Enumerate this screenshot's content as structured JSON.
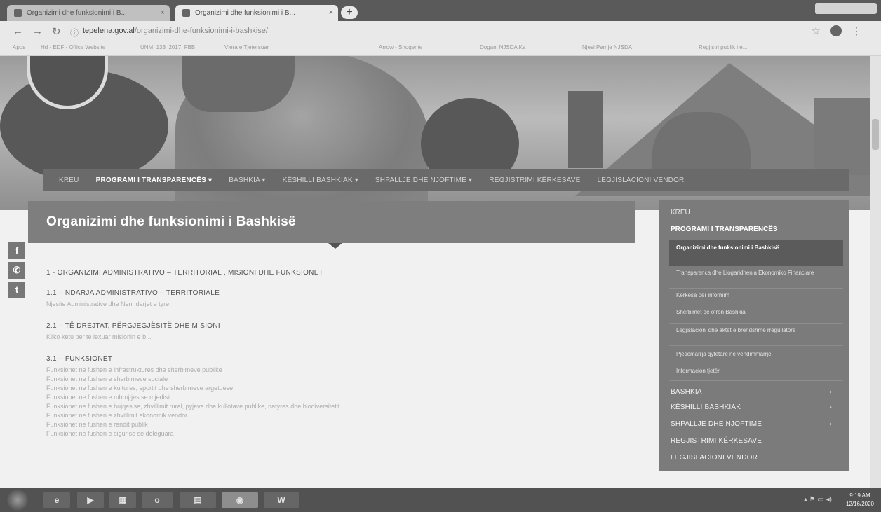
{
  "browser": {
    "tabs": [
      {
        "label": "Organizimi dhe funksionimi i B...",
        "active": false
      },
      {
        "label": "Organizimi dhe funksionimi i B...",
        "active": true
      }
    ],
    "url_domain": "tepelena.gov.al",
    "url_path": "/organizimi-dhe-funksionimi-i-bashkise/",
    "bookmarks": [
      "Apps",
      "Hd - EDF - Office Website",
      "UNM_133_2017_FBB",
      "Vlera e Tjetersuar",
      "Arrow - Shoqerite",
      "Doganj NJSDA Ka",
      "Njesi Pamje NJSDA",
      "Regjistri publik i e..."
    ]
  },
  "site": {
    "nav": [
      {
        "label": "KREU",
        "active": false
      },
      {
        "label": "PROGRAMI I TRANSPARENCËS",
        "dropdown": true,
        "active": true
      },
      {
        "label": "BASHKIA",
        "dropdown": true,
        "active": false
      },
      {
        "label": "KËSHILLI BASHKIAK",
        "dropdown": true,
        "active": false
      },
      {
        "label": "SHPALLJE DHE NJOFTIME",
        "dropdown": true,
        "active": false
      },
      {
        "label": "REGJISTRIMI KËRKESAVE",
        "active": false
      },
      {
        "label": "LEGJISLACIONI VENDOR",
        "active": false
      }
    ],
    "social": [
      "facebook-icon",
      "whatsapp-icon",
      "twitter-icon"
    ],
    "page_title": "Organizimi dhe funksionimi i Bashkisë",
    "content": {
      "main_heading": "1 - ORGANIZIMI ADMINISTRATIVO – TERRITORIAL , MISIONI DHE FUNKSIONET",
      "sections": [
        {
          "heading": "1.1 – NDARJA ADMINISTRATIVO – TERRITORIALE",
          "lines": [
            "Njesite Administrative dhe Nenndarjet e tyre"
          ]
        },
        {
          "heading": "2.1 – TË DREJTAT, PËRGJEGJËSITË DHE MISIONI",
          "lines": [
            "Kliko ketu per te lexuar misionin e b..."
          ]
        },
        {
          "heading": "3.1 – FUNKSIONET",
          "lines": [
            "Funksionet ne fushen e infrastruktures dhe sherbimeve publike",
            "Funksionet ne fushen e sherbimeve sociale",
            "Funksionet ne fushen e kultures, sportit dhe sherbimeve argetuese",
            "Funksionet ne fushen e mbrojtjes se mjedisit",
            "Funksionet ne fushen e bujqesise, zhvillimit rural, pyjeve dhe kullotave publike, natyres dhe biodiversitetit",
            "Funksionet ne fushen e zhvillimit ekonomik vendor",
            "Funksionet ne fushen e rendit publik",
            "Funksionet ne fushen e sigurise se deleguara"
          ]
        }
      ]
    },
    "sidebar": {
      "top_items": [
        "KREU",
        "PROGRAMI I TRANSPARENCËS"
      ],
      "sub_items": [
        {
          "label": "Organizimi dhe funksionimi i Bashkisë",
          "active": true
        },
        {
          "label": "Transparenca dhe Llogaridhenia Ekonomiko Financiare",
          "active": false
        },
        {
          "label": "Kërkesa për informim",
          "active": false
        },
        {
          "label": "Shërbimet qe ofron Bashkia",
          "active": false
        },
        {
          "label": "Legjislacioni dhe aktet e brendshme rregullatore",
          "active": false
        },
        {
          "label": "Pjesemarrja qytetare ne vendimmarrje",
          "active": false
        },
        {
          "label": "Informacion tjetër",
          "active": false
        }
      ],
      "lower_items": [
        {
          "label": "BASHKIA",
          "chevron": "›"
        },
        {
          "label": "KËSHILLI BASHKIAK",
          "chevron": "›"
        },
        {
          "label": "SHPALLJE DHE NJOFTIME",
          "chevron": "›"
        },
        {
          "label": "REGJISTRIMI KËRKESAVE",
          "chevron": ""
        },
        {
          "label": "LEGJISLACIONI VENDOR",
          "chevron": ""
        }
      ]
    }
  },
  "taskbar": {
    "apps": [
      "ie-icon",
      "media-player-icon",
      "windows-explorer-icon",
      "outlook-icon",
      "folder-icon",
      "chrome-icon",
      "word-icon"
    ],
    "time": "9:19 AM",
    "date": "12/16/2020"
  }
}
